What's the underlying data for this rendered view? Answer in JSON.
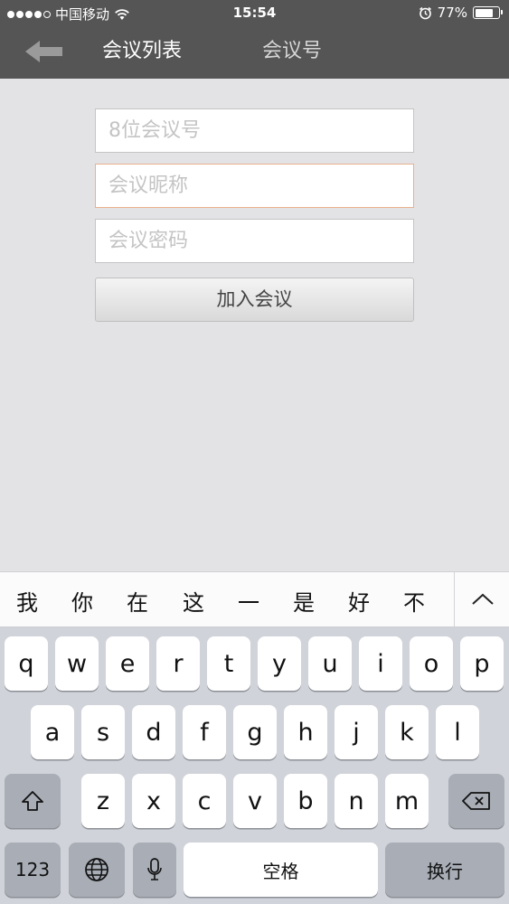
{
  "status_bar": {
    "carrier": "中国移动",
    "time": "15:54",
    "battery": "77%",
    "battery_level": 0.77,
    "icons": [
      "signal-dots",
      "wifi-icon",
      "alarm-icon",
      "battery-icon"
    ]
  },
  "nav": {
    "back_icon": "back-arrow-icon",
    "tab_meeting_list": "会议列表",
    "tab_meeting_number": "会议号"
  },
  "form": {
    "meeting_number_placeholder": "8位会议号",
    "nickname_placeholder": "会议昵称",
    "password_placeholder": "会议密码",
    "join_button": "加入会议"
  },
  "candidates": {
    "items": [
      "我",
      "你",
      "在",
      "这",
      "一",
      "是",
      "好",
      "不"
    ],
    "expand_icon": "chevron-up-icon"
  },
  "keyboard": {
    "row1": [
      "q",
      "w",
      "e",
      "r",
      "t",
      "y",
      "u",
      "i",
      "o",
      "p"
    ],
    "row2": [
      "a",
      "s",
      "d",
      "f",
      "g",
      "h",
      "j",
      "k",
      "l"
    ],
    "row3": [
      "z",
      "x",
      "c",
      "v",
      "b",
      "n",
      "m"
    ],
    "numbers_key": "123",
    "space_key": "空格",
    "return_key": "换行"
  },
  "colors": {
    "header_bg": "#555555",
    "body_bg": "#e3e3e6",
    "focus_border": "#e9b08d",
    "keyboard_bg": "#d0d3d9"
  }
}
